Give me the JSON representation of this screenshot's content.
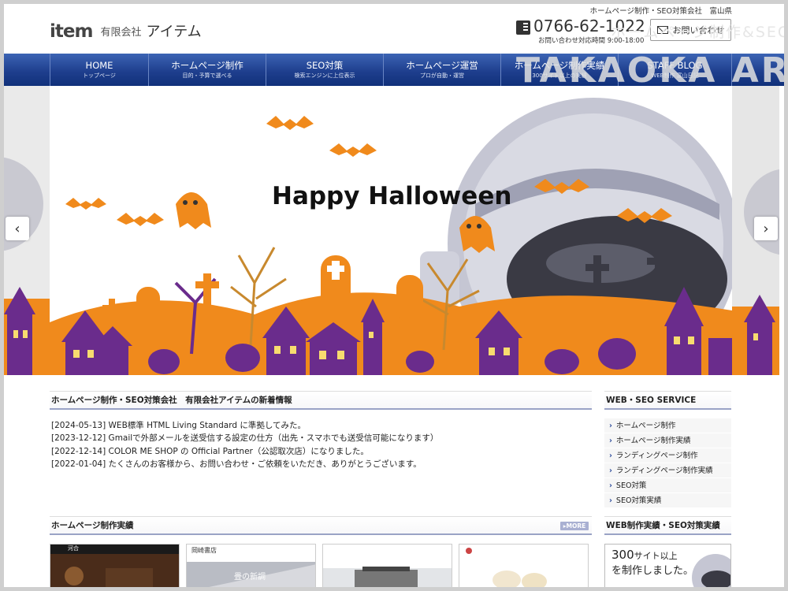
{
  "header": {
    "top_text": "ホームページ制作・SEO対策会社　富山県",
    "logo_mark": "item",
    "logo_company": "有限会社",
    "logo_name": "アイテム",
    "phone": "0766-62-1022",
    "hours": "お問い合わせ対応時間  9:00-18:00",
    "contact_label": "お問い合わせ",
    "overlay_small": "ホームページ制作&SEO",
    "overlay_big": "TAKAOKA AREA"
  },
  "nav": [
    {
      "label": "HOME",
      "sub": "トップページ"
    },
    {
      "label": "ホームページ制作",
      "sub": "目的・予算で選べる"
    },
    {
      "label": "SEO対策",
      "sub": "検索エンジンに上位表示"
    },
    {
      "label": "ホームページ運営",
      "sub": "プロが自動・運営"
    },
    {
      "label": "ホームページ制作実績",
      "sub": "300サイト以上の実績"
    },
    {
      "label": "STAFF BLOG",
      "sub": "WEB制作 富山日記"
    }
  ],
  "banner": {
    "title": "Happy Halloween",
    "prev_label": "‹",
    "next_label": "›",
    "colors": {
      "orange": "#f08a1c",
      "purple": "#6a2c8c",
      "yellow": "#f7dc6f"
    }
  },
  "news": {
    "heading": "ホームページ制作・SEO対策会社　有限会社アイテムの新着情報",
    "items": [
      "[2024-05-13] WEB標準 HTML Living Standard に準拠してみた。",
      "[2023-12-12] Gmailで外部メールを送受信する設定の仕方（出先・スマホでも送受信可能になります）",
      "[2022-12-14] COLOR ME SHOP の Official Partner（公認取次店）になりました。",
      "[2022-01-04] たくさんのお客様から、お問い合わせ・ご依頼をいただき、ありがとうございます。"
    ]
  },
  "services": {
    "heading": "WEB・SEO SERVICE",
    "items": [
      "ホームページ制作",
      "ホームページ制作実績",
      "ランディングページ制作",
      "ランディングページ制作実績",
      "SEO対策",
      "SEO対策実績"
    ]
  },
  "works": {
    "heading": "ホームページ制作実績",
    "more_label": "MORE",
    "thumb1_title": "河合",
    "thumb2_title": "岡崎書店",
    "thumb2_caption": "畳の新調"
  },
  "results": {
    "heading": "WEB制作実績・SEO対策実績",
    "line1": "300",
    "line1_suffix": "サイト以上",
    "line2": "を制作しました。"
  }
}
